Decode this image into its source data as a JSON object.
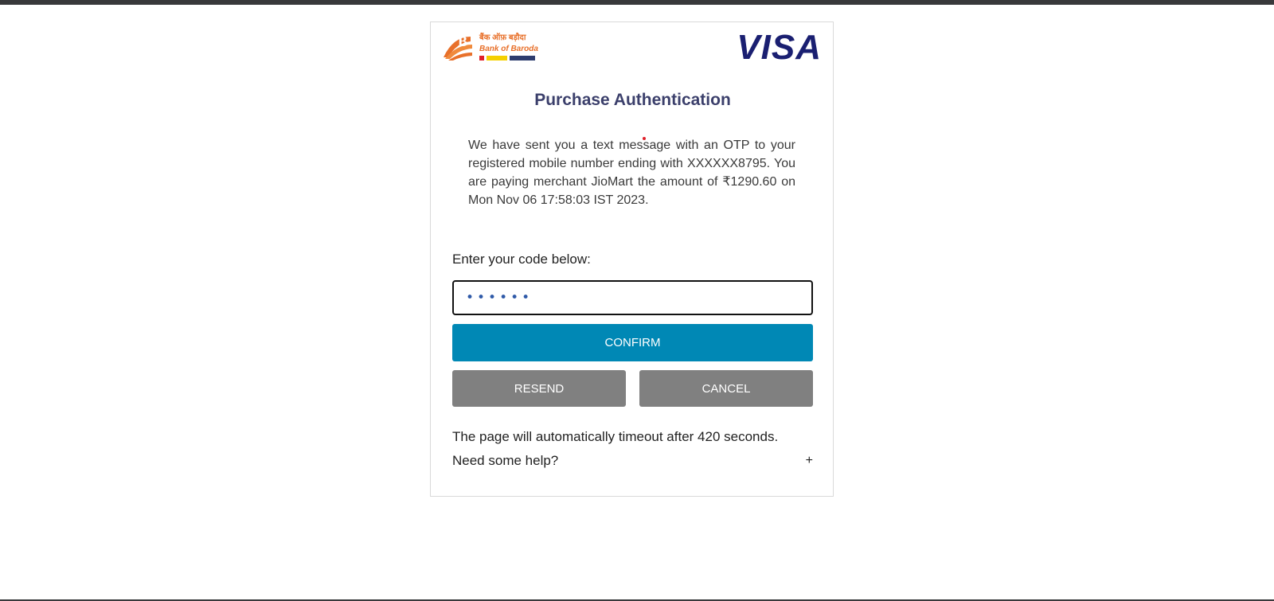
{
  "colors": {
    "title": "#3b3f6b",
    "confirm": "#0088b5",
    "secondary": "#808080",
    "visa": "#1a1f71",
    "bob_orange": "#e8702a"
  },
  "bank_logo": {
    "hindi": "बैंक ऑफ़ बड़ौदा",
    "english": "Bank of Baroda",
    "icon": "bank-of-baroda-logo"
  },
  "visa_logo": "VISA",
  "title": "Purchase Authentication",
  "message": "We have sent you a text message with an OTP to your registered mobile number ending with XXXXXX8795. You are paying merchant JioMart the amount of ₹1290.60 on Mon Nov 06 17:58:03 IST 2023.",
  "code_label": "Enter your code below:",
  "otp_value": "••••••",
  "buttons": {
    "confirm": "CONFIRM",
    "resend": "RESEND",
    "cancel": "CANCEL"
  },
  "timeout_text": "The page will automatically timeout after 420 seconds.",
  "help": {
    "text": "Need some help?",
    "icon": "+"
  }
}
